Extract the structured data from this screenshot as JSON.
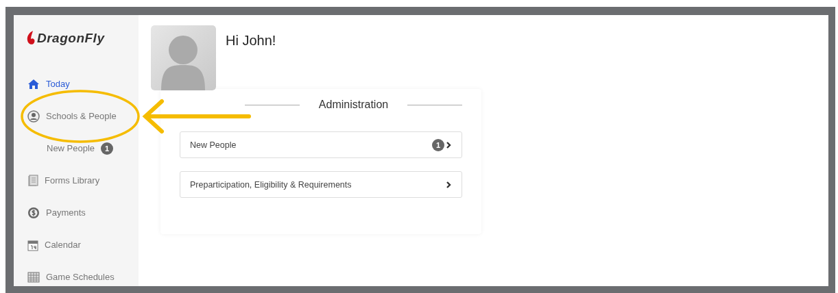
{
  "sidebar": {
    "logo": "DragonFly",
    "items": [
      {
        "kind": "home",
        "label": "Today",
        "selected": true
      },
      {
        "kind": "person",
        "label": "Schools & People",
        "selected": false
      },
      {
        "kind": "sub",
        "label": "New People",
        "badge": "1",
        "selected": false
      },
      {
        "kind": "forms",
        "label": "Forms Library",
        "selected": false
      },
      {
        "kind": "payments",
        "label": "Payments",
        "selected": false
      },
      {
        "kind": "calendar",
        "label": "Calendar",
        "selected": false
      },
      {
        "kind": "grid",
        "label": "Game Schedules",
        "selected": false
      }
    ]
  },
  "greeting": "Hi John!",
  "panel": {
    "title": "Administration",
    "rows": [
      {
        "label": "New People",
        "badge": "1"
      },
      {
        "label": "Preparticipation, Eligibility & Requirements"
      }
    ]
  },
  "annotation": {
    "highlight_ring": true,
    "arrow": true
  }
}
